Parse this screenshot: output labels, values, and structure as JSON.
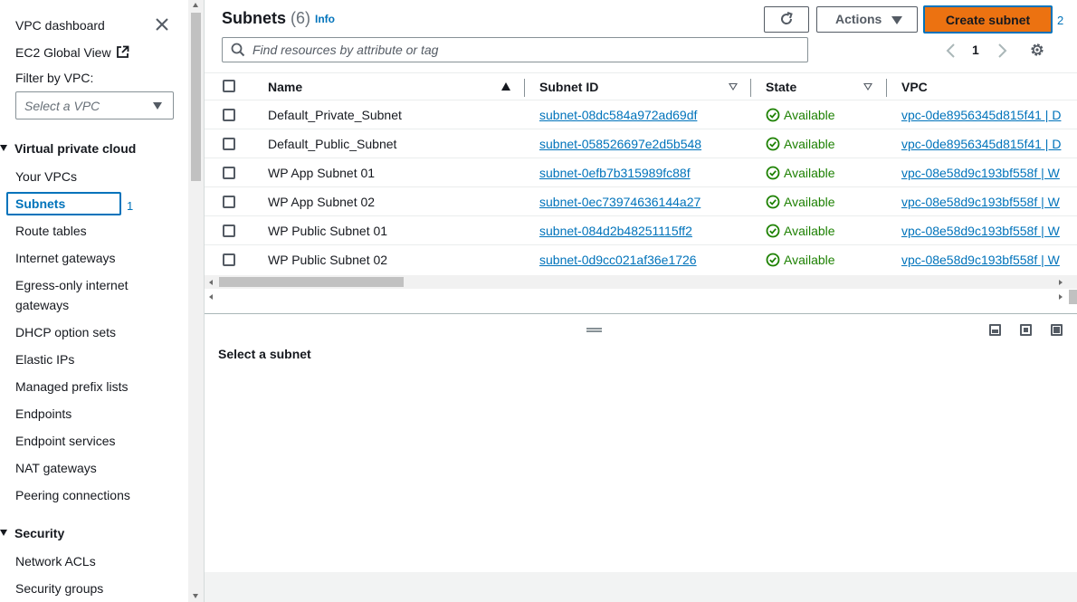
{
  "sidebar": {
    "dashboard": "VPC dashboard",
    "ec2_global_view": "EC2 Global View",
    "filter_label": "Filter by VPC:",
    "filter_placeholder": "Select a VPC",
    "section_vpc": "Virtual private cloud",
    "items": [
      "Your VPCs",
      "Subnets",
      "Route tables",
      "Internet gateways",
      "Egress-only internet",
      "gateways",
      "DHCP option sets",
      "Elastic IPs",
      "Managed prefix lists",
      "Endpoints",
      "Endpoint services",
      "NAT gateways",
      "Peering connections"
    ],
    "section_security": "Security",
    "security_items": [
      "Network ACLs",
      "Security groups"
    ],
    "marker": "1"
  },
  "header": {
    "title": "Subnets",
    "count": "(6)",
    "info": "Info",
    "actions": "Actions",
    "create": "Create subnet",
    "marker": "2"
  },
  "search": {
    "placeholder": "Find resources by attribute or tag"
  },
  "pagination": {
    "page": "1"
  },
  "table": {
    "columns": [
      "Name",
      "Subnet ID",
      "State",
      "VPC"
    ],
    "rows": [
      {
        "name": "Default_Private_Subnet",
        "id": "subnet-08dc584a972ad69df",
        "state": "Available",
        "vpc": "vpc-0de8956345d815f41 | D"
      },
      {
        "name": "Default_Public_Subnet",
        "id": "subnet-058526697e2d5b548",
        "state": "Available",
        "vpc": "vpc-0de8956345d815f41 | D"
      },
      {
        "name": "WP App Subnet 01",
        "id": "subnet-0efb7b315989fc88f",
        "state": "Available",
        "vpc": "vpc-08e58d9c193bf558f | W"
      },
      {
        "name": "WP App Subnet 02",
        "id": "subnet-0ec73974636144a27",
        "state": "Available",
        "vpc": "vpc-08e58d9c193bf558f | W"
      },
      {
        "name": "WP Public Subnet 01",
        "id": "subnet-084d2b48251115ff2",
        "state": "Available",
        "vpc": "vpc-08e58d9c193bf558f | W"
      },
      {
        "name": "WP Public Subnet 02",
        "id": "subnet-0d9cc021af36e1726",
        "state": "Available",
        "vpc": "vpc-08e58d9c193bf558f | W"
      }
    ]
  },
  "split_panel": {
    "label": "Select a subnet"
  },
  "colors": {
    "accent": "#0073bb",
    "primary_button": "#ec7211",
    "success": "#1d8102"
  }
}
